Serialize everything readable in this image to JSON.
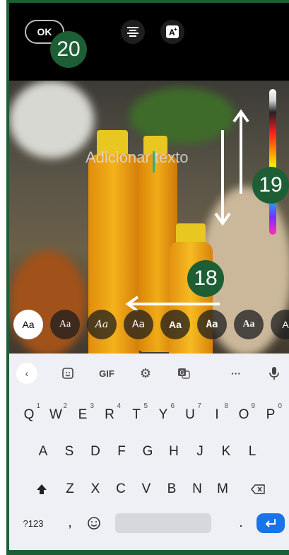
{
  "topbar": {
    "ok_label": "OK"
  },
  "badges": {
    "b20": "20",
    "b19": "19",
    "b18": "18"
  },
  "editor": {
    "placeholder": "Adicionar texto"
  },
  "font_styles": [
    "Aa",
    "Aa",
    "Aa",
    "Aa",
    "Aa",
    "Aa",
    "Aa",
    "A"
  ],
  "keyboard": {
    "tools": {
      "gif": "GIF",
      "more": "···"
    },
    "row1": [
      "Q",
      "W",
      "E",
      "R",
      "T",
      "Y",
      "U",
      "I",
      "O",
      "P"
    ],
    "row1_hints": [
      "1",
      "2",
      "3",
      "4",
      "5",
      "6",
      "7",
      "8",
      "9",
      "0"
    ],
    "row2": [
      "A",
      "S",
      "D",
      "F",
      "G",
      "H",
      "J",
      "K",
      "L"
    ],
    "row3": [
      "Z",
      "X",
      "C",
      "V",
      "B",
      "N",
      "M"
    ],
    "symbols_label": "?123",
    "comma": ",",
    "period": "."
  },
  "colors": {
    "frame": "#1d5e35",
    "accent": "#1a73e8",
    "cursor": "#2bb08d"
  }
}
